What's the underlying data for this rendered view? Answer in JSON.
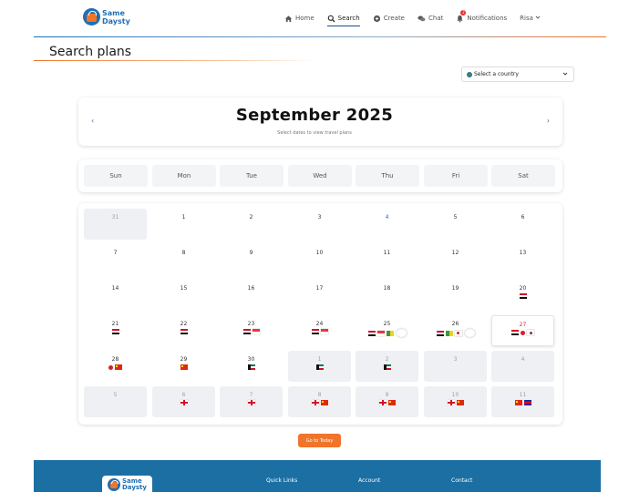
{
  "brand": {
    "line1": "Same",
    "line2": "Daysty"
  },
  "nav": {
    "items": [
      {
        "label": "Home",
        "icon": "home-icon"
      },
      {
        "label": "Search",
        "icon": "search-icon"
      },
      {
        "label": "Create",
        "icon": "plus-circle-icon"
      },
      {
        "label": "Chat",
        "icon": "chat-icon"
      },
      {
        "label": "Notifications",
        "icon": "bell-icon"
      }
    ],
    "active": "Search",
    "notification_count": "2",
    "user": "Risa"
  },
  "page": {
    "title": "Search plans"
  },
  "country_select": {
    "value": "Select a country"
  },
  "calendar": {
    "month_title": "September 2025",
    "subtitle": "Select dates to view travel plans",
    "prev": "‹",
    "next": "›",
    "weekdays": [
      "Sun",
      "Mon",
      "Tue",
      "Wed",
      "Thu",
      "Fri",
      "Sat"
    ],
    "days": [
      {
        "n": "31",
        "outside": true,
        "flags": []
      },
      {
        "n": "1",
        "flags": []
      },
      {
        "n": "2",
        "flags": []
      },
      {
        "n": "3",
        "flags": []
      },
      {
        "n": "4",
        "flags": [],
        "highlight": true
      },
      {
        "n": "5",
        "flags": []
      },
      {
        "n": "6",
        "flags": []
      },
      {
        "n": "7",
        "flags": []
      },
      {
        "n": "8",
        "flags": []
      },
      {
        "n": "9",
        "flags": []
      },
      {
        "n": "10",
        "flags": []
      },
      {
        "n": "11",
        "flags": []
      },
      {
        "n": "12",
        "flags": []
      },
      {
        "n": "13",
        "flags": []
      },
      {
        "n": "14",
        "flags": []
      },
      {
        "n": "15",
        "flags": []
      },
      {
        "n": "16",
        "flags": []
      },
      {
        "n": "17",
        "flags": []
      },
      {
        "n": "18",
        "flags": []
      },
      {
        "n": "19",
        "flags": []
      },
      {
        "n": "20",
        "flags": [
          "egypt"
        ]
      },
      {
        "n": "21",
        "flags": [
          "egypt"
        ]
      },
      {
        "n": "22",
        "flags": [
          "egypt"
        ]
      },
      {
        "n": "23",
        "flags": [
          "egypt",
          "singapore"
        ]
      },
      {
        "n": "24",
        "flags": [
          "egypt",
          "singapore"
        ]
      },
      {
        "n": "25",
        "flags": [
          "egypt",
          "singapore",
          "yellow-green"
        ],
        "more": true
      },
      {
        "n": "26",
        "flags": [
          "egypt",
          "yellow-green",
          "japan-w"
        ],
        "more": true
      },
      {
        "n": "27",
        "flags": [
          "egypt",
          "japan",
          "korea"
        ],
        "today": true
      },
      {
        "n": "28",
        "flags": [
          "japan",
          "china"
        ]
      },
      {
        "n": "29",
        "flags": [
          "china"
        ]
      },
      {
        "n": "30",
        "flags": [
          "kuwait"
        ]
      },
      {
        "n": "1",
        "outside": true,
        "flags": [
          "kuwait"
        ]
      },
      {
        "n": "2",
        "outside": true,
        "flags": [
          "kuwait"
        ]
      },
      {
        "n": "3",
        "outside": true,
        "flags": []
      },
      {
        "n": "4",
        "outside": true,
        "flags": []
      },
      {
        "n": "5",
        "outside": true,
        "flags": []
      },
      {
        "n": "6",
        "outside": true,
        "flags": [
          "england"
        ]
      },
      {
        "n": "7",
        "outside": true,
        "flags": [
          "england"
        ]
      },
      {
        "n": "8",
        "outside": true,
        "flags": [
          "england",
          "china"
        ]
      },
      {
        "n": "9",
        "outside": true,
        "flags": [
          "england",
          "china"
        ]
      },
      {
        "n": "10",
        "outside": true,
        "flags": [
          "england",
          "china"
        ]
      },
      {
        "n": "11",
        "outside": true,
        "flags": [
          "china",
          "cambodia"
        ]
      }
    ]
  },
  "today_button": "Go to Today",
  "footer": {
    "brand_line1": "Same",
    "brand_line2": "Daysty",
    "columns": [
      "Quick Links",
      "Account",
      "Contact"
    ]
  },
  "colors": {
    "brand_blue": "#1f6fb5",
    "accent_orange": "#f0742a",
    "footer_blue": "#1b6fa3",
    "today_red": "#d4243a"
  }
}
